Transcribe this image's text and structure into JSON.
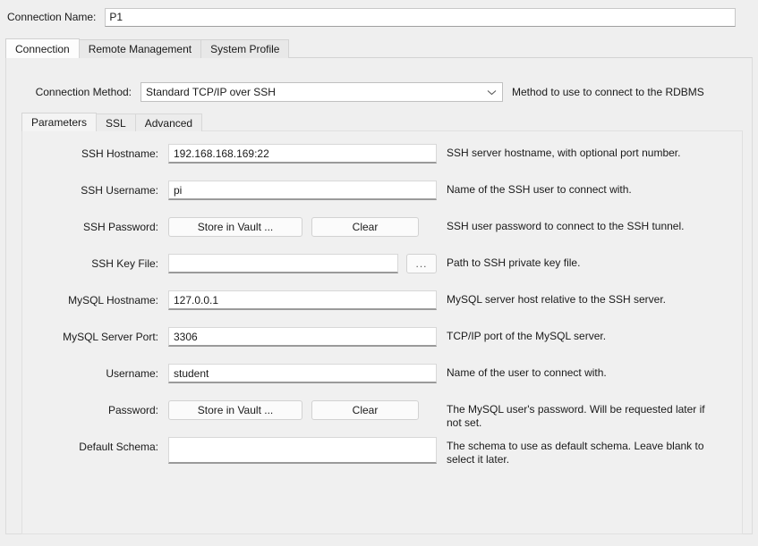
{
  "connection_name": {
    "label": "Connection Name:",
    "value": "P1"
  },
  "tabs": [
    {
      "label": "Connection",
      "active": true
    },
    {
      "label": "Remote Management",
      "active": false
    },
    {
      "label": "System Profile",
      "active": false
    }
  ],
  "connection_method": {
    "label": "Connection Method:",
    "value": "Standard TCP/IP over SSH",
    "hint": "Method to use to connect to the RDBMS",
    "chevron_icon": "chevron-down-icon"
  },
  "subtabs": [
    {
      "label": "Parameters",
      "active": true
    },
    {
      "label": "SSL",
      "active": false
    },
    {
      "label": "Advanced",
      "active": false
    }
  ],
  "parameters": {
    "rows": [
      {
        "label": "SSH Hostname:",
        "type": "text",
        "value": "192.168.168.169:22",
        "help": "SSH server hostname, with  optional port number."
      },
      {
        "label": "SSH Username:",
        "type": "text",
        "value": "pi",
        "help": "Name of the SSH user to connect with."
      },
      {
        "label": "SSH Password:",
        "type": "buttons",
        "primary_button": "Store in Vault ...",
        "secondary_button": "Clear",
        "help": "SSH user password to connect to the SSH tunnel."
      },
      {
        "label": "SSH Key File:",
        "type": "text-browse",
        "value": "",
        "browse_button": "...",
        "help": "Path to SSH private key file."
      },
      {
        "label": "MySQL Hostname:",
        "type": "text",
        "value": "127.0.0.1",
        "help": "MySQL server host relative to the SSH server."
      },
      {
        "label": "MySQL Server Port:",
        "type": "text",
        "value": "3306",
        "help": "TCP/IP port of the MySQL server."
      },
      {
        "label": "Username:",
        "type": "text",
        "value": "student",
        "help": "Name of the user to connect with."
      },
      {
        "label": "Password:",
        "type": "buttons",
        "primary_button": "Store in Vault ...",
        "secondary_button": "Clear",
        "help": "The MySQL user's password. Will be requested later if not set."
      },
      {
        "label": "Default Schema:",
        "type": "text-tall",
        "value": "",
        "help": "The schema to use as default schema. Leave blank to select it later."
      }
    ]
  },
  "colors": {
    "window_bg": "#efefef",
    "panel_bg": "#f0f0f0",
    "field_bg": "#ffffff",
    "active_tab_bg": "#fdfdfd",
    "text": "#1a1a1a"
  }
}
